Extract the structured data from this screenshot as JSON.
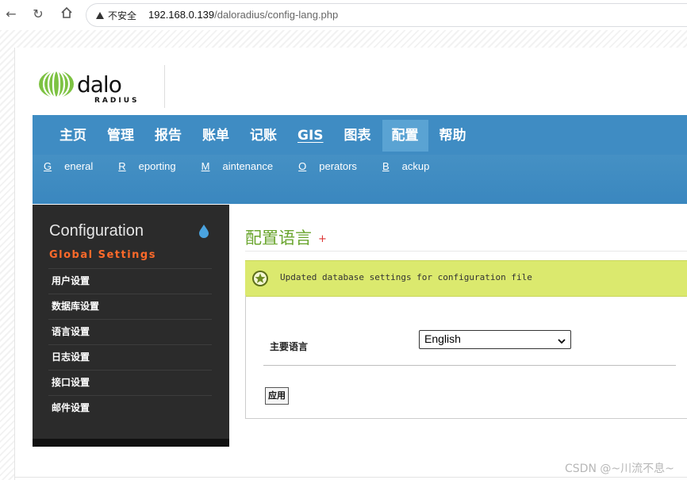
{
  "browser": {
    "security_label": "不安全",
    "url_host": "192.168.0.139",
    "url_path": "/daloradius/config-lang.php"
  },
  "logo": {
    "brand": "dalo",
    "sub": "RADIUS"
  },
  "mainnav": {
    "items": [
      "主页",
      "管理",
      "报告",
      "账单",
      "记账",
      "GIS",
      "图表",
      "配置",
      "帮助"
    ],
    "active": "配置"
  },
  "subnav": {
    "items": [
      {
        "first": "G",
        "rest": "eneral"
      },
      {
        "first": "R",
        "rest": "eporting"
      },
      {
        "first": "M",
        "rest": "aintenance"
      },
      {
        "first": "O",
        "rest": "perators"
      },
      {
        "first": "B",
        "rest": "ackup"
      }
    ]
  },
  "sidebar": {
    "title": "Configuration",
    "subtitle": "Global Settings",
    "items": [
      "用户设置",
      "数据库设置",
      "语言设置",
      "日志设置",
      "接口设置",
      "邮件设置"
    ]
  },
  "content": {
    "title": "配置语言",
    "plus": "+",
    "notice": "Updated database settings for configuration file",
    "form": {
      "label": "主要语言",
      "select_value": "English",
      "submit_label": "应用"
    }
  },
  "watermark": "CSDN @~川流不息~",
  "colors": {
    "nav_blue": "#3f8cc3",
    "active_tab": "#5aa3d3",
    "title_green": "#6aa52e",
    "notice_bg": "#dbe96e",
    "sidebar_bg": "#2b2b2b",
    "sidebar_accent": "#ff6a2a"
  }
}
